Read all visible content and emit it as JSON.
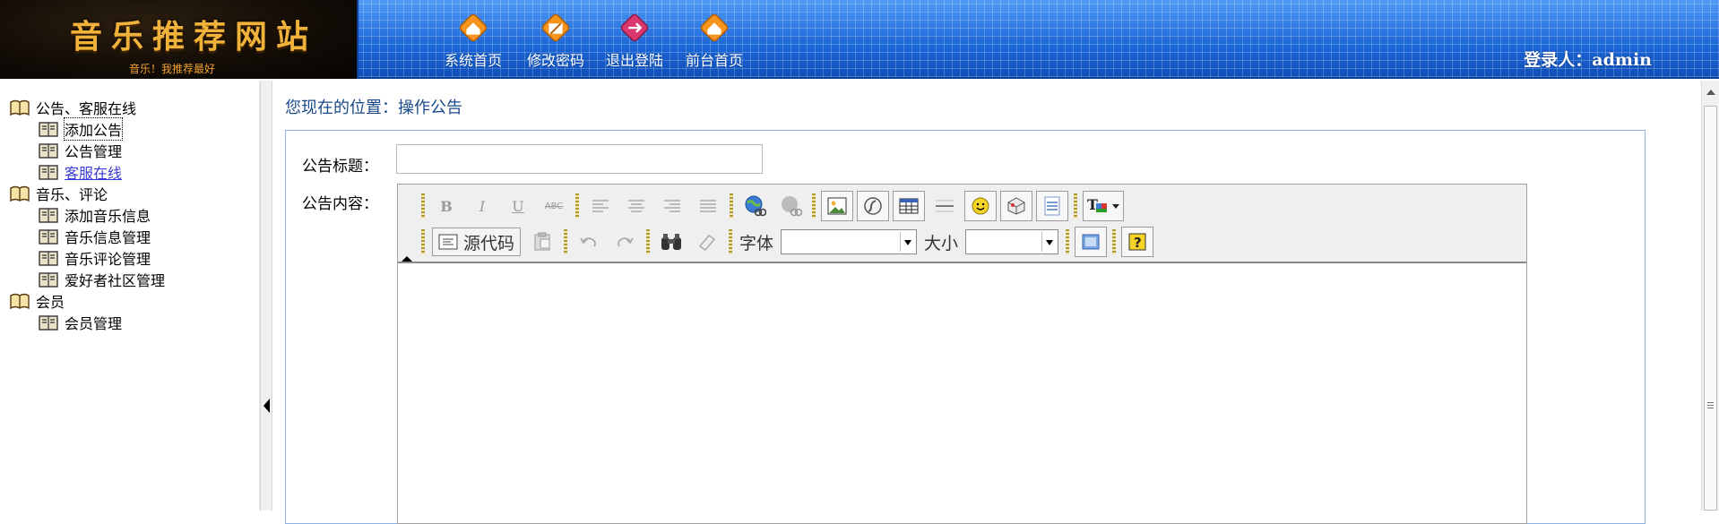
{
  "header": {
    "site_title": "音乐推荐网站",
    "site_subtitle": "音乐！我推荐最好",
    "nav": [
      {
        "label": "系统首页",
        "icon": "home-icon",
        "color": "#f7941d"
      },
      {
        "label": "修改密码",
        "icon": "edit-icon",
        "color": "#f7941d"
      },
      {
        "label": "退出登陆",
        "icon": "logout-icon",
        "color": "#d9386f"
      },
      {
        "label": "前台首页",
        "icon": "home-icon",
        "color": "#f7941d"
      }
    ],
    "login_label": "登录人：admin"
  },
  "sidebar": {
    "groups": [
      {
        "label": "公告、客服在线",
        "items": [
          {
            "label": "添加公告",
            "state": "focused"
          },
          {
            "label": "公告管理",
            "state": "normal"
          },
          {
            "label": "客服在线",
            "state": "visited"
          }
        ]
      },
      {
        "label": "音乐、评论",
        "items": [
          {
            "label": "添加音乐信息",
            "state": "normal"
          },
          {
            "label": "音乐信息管理",
            "state": "normal"
          },
          {
            "label": "音乐评论管理",
            "state": "normal"
          },
          {
            "label": "爱好者社区管理",
            "state": "normal"
          }
        ]
      },
      {
        "label": "会员",
        "items": [
          {
            "label": "会员管理",
            "state": "normal"
          }
        ]
      }
    ]
  },
  "main": {
    "breadcrumb": "您现在的位置：操作公告",
    "form": {
      "title_label": "公告标题：",
      "title_value": "",
      "content_label": "公告内容："
    }
  },
  "editor": {
    "row1": [
      "B",
      "I",
      "U",
      "ABC"
    ],
    "source_label": "源代码",
    "font_label": "字体",
    "size_label": "大小",
    "font_value": "",
    "size_value": ""
  },
  "colors": {
    "header_blue": "#1b66d6",
    "logo_gold": "#f0b23a",
    "breadcrumb": "#1a4a8a",
    "panel_border": "#8db2e3"
  }
}
